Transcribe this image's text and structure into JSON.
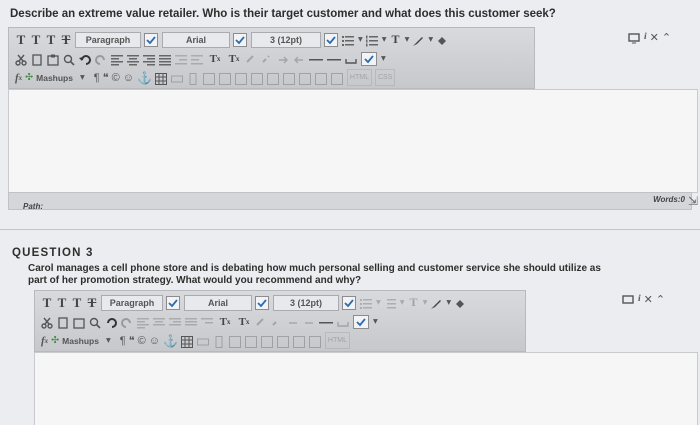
{
  "q2": {
    "text": "Describe an extreme value retailer. Who is their target customer and what does this customer seek?",
    "toolbar": {
      "tt1": "T",
      "tt2": "T",
      "tt3": "T",
      "tt4": "T",
      "paragraph": "Paragraph",
      "font": "Arial",
      "size": "3 (12pt)",
      "mashups": "Mashups",
      "html": "HTML",
      "css": "CSS"
    },
    "path_label": "Path:",
    "words_label": "Words:0"
  },
  "q3": {
    "heading": "QUESTION 3",
    "text_line1": "Carol manages a cell phone store and is debating how much personal selling and customer service she should utilize as",
    "text_line2": "part of her promotion strategy. What would you recommend and why?",
    "toolbar": {
      "tt1": "T",
      "tt2": "T",
      "tt3": "T",
      "tt4": "T",
      "paragraph": "Paragraph",
      "font": "Arial",
      "size": "3 (12pt)",
      "mashups": "Mashups",
      "html": "HTML"
    }
  },
  "colors": {
    "background": "#ecedf0",
    "toolbar": "#cfd1d5",
    "editor": "#f6f6f7",
    "accent_check": "#2a6db0"
  }
}
